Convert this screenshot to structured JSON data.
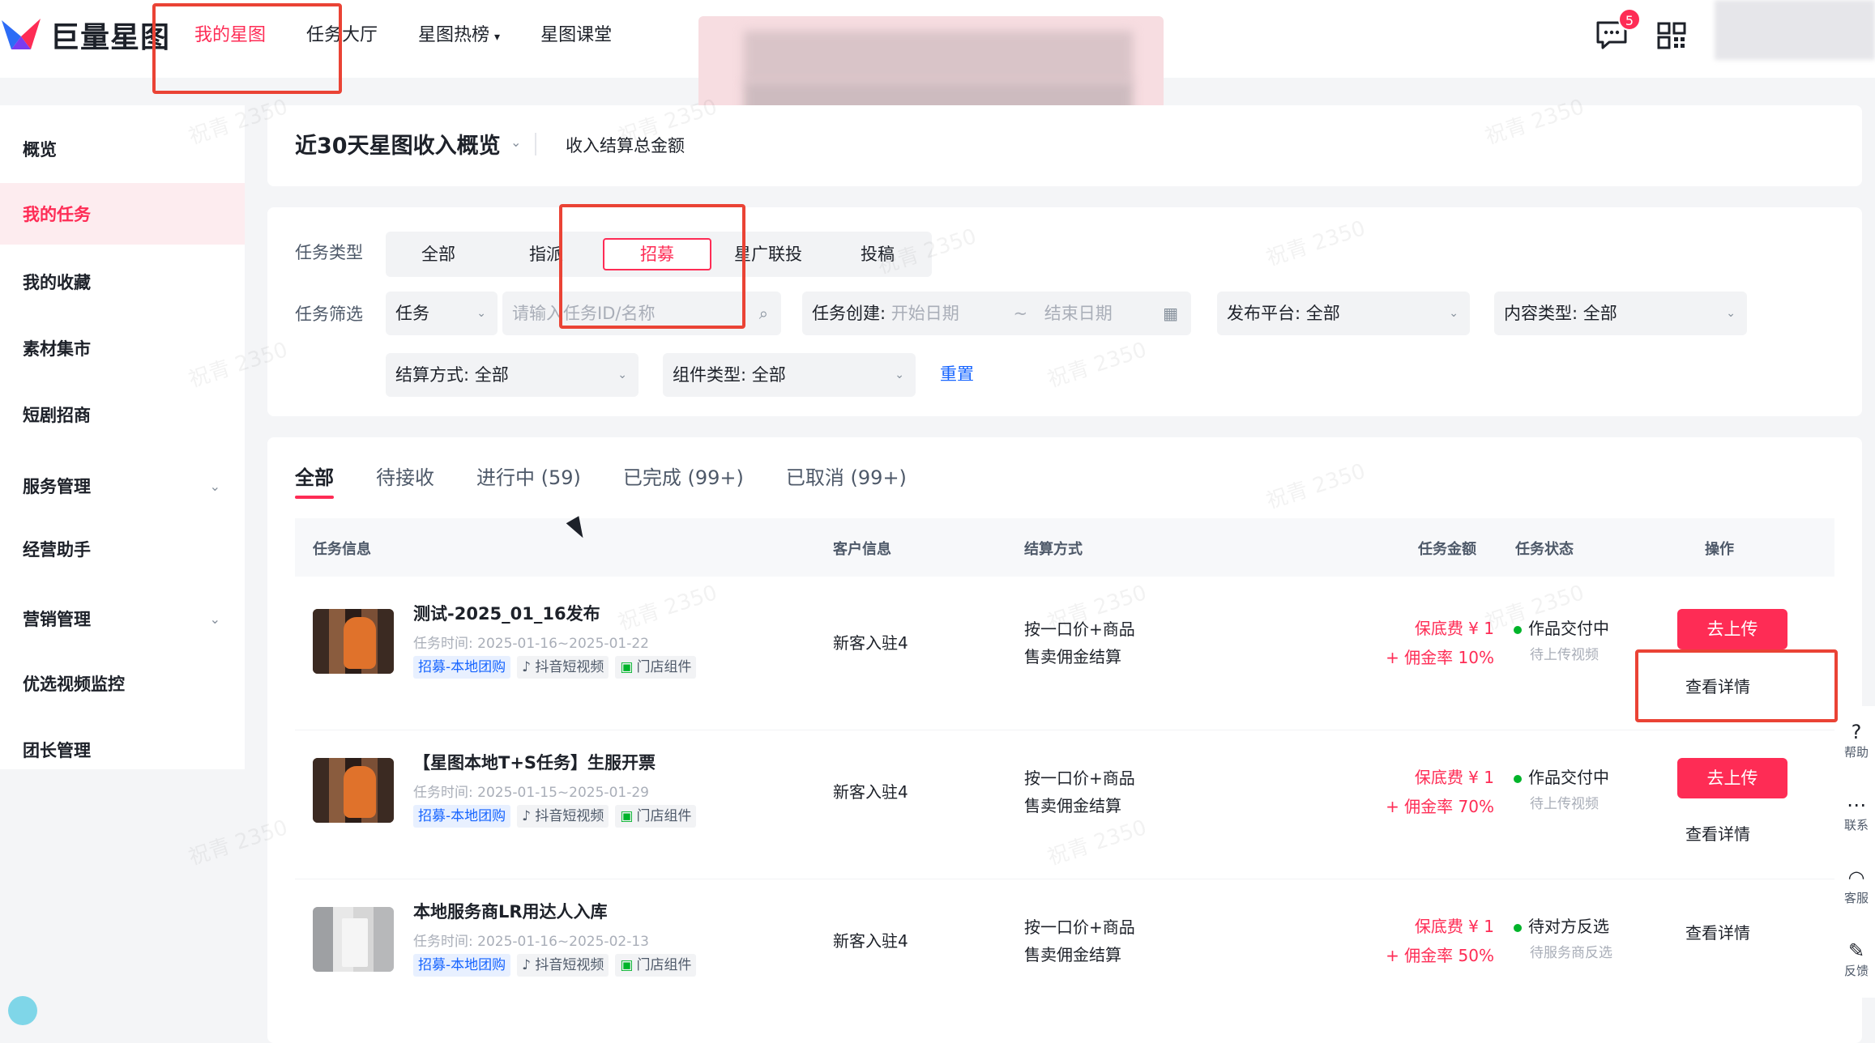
{
  "brand": {
    "name": "巨量星图",
    "accent": "#fe2c55"
  },
  "nav": [
    {
      "label": "我的星图",
      "active": true
    },
    {
      "label": "任务大厅",
      "active": false
    },
    {
      "label": "星图热榜",
      "active": false,
      "caret": "▾"
    },
    {
      "label": "星图课堂",
      "active": false
    }
  ],
  "header": {
    "message_badge": "5"
  },
  "sidebar": [
    {
      "label": "概览"
    },
    {
      "label": "我的任务",
      "active": true
    },
    {
      "label": "我的收藏"
    },
    {
      "label": "素材集市"
    },
    {
      "label": "短剧招商"
    },
    {
      "label": "服务管理",
      "chevron": "⌄"
    },
    {
      "label": "经营助手"
    },
    {
      "label": "营销管理",
      "chevron": "⌄"
    },
    {
      "label": "优选视频监控"
    },
    {
      "label": "团长管理"
    }
  ],
  "summary": {
    "title": "近30天星图收入概览",
    "caret": "⌄",
    "sub": "收入结算总金额"
  },
  "filters": {
    "type_label": "任务类型",
    "types": [
      {
        "label": "全部"
      },
      {
        "label": "指派"
      },
      {
        "label": "招募",
        "selected": true
      },
      {
        "label": "星广联投"
      },
      {
        "label": "投稿"
      }
    ],
    "screen_label": "任务筛选",
    "task_select": "任务",
    "search_placeholder": "请输入任务ID/名称",
    "created_label": "任务创建:",
    "start_placeholder": "开始日期",
    "range_sep": "~",
    "end_placeholder": "结束日期",
    "platform": "发布平台: 全部",
    "content_type": "内容类型: 全部",
    "settle_method": "结算方式: 全部",
    "component_type": "组件类型: 全部",
    "reset": "重置"
  },
  "tabs": [
    {
      "label": "全部",
      "active": true
    },
    {
      "label": "待接收"
    },
    {
      "label": "进行中 (59)"
    },
    {
      "label": "已完成 (99+)"
    },
    {
      "label": "已取消 (99+)"
    }
  ],
  "table": {
    "headers": [
      "任务信息",
      "客户信息",
      "结算方式",
      "任务金额",
      "任务状态",
      "操作"
    ],
    "rows": [
      {
        "title": "测试-2025_01_16发布",
        "time": "任务时间: 2025-01-16~2025-01-22",
        "tags": [
          "招募-本地团购",
          "♪ 抖音短视频",
          "门店组件"
        ],
        "customer": "新客入驻4",
        "settle1": "按一口价+商品",
        "settle2": "售卖佣金结算",
        "amount1": "保底费 ¥ 1",
        "amount2": "+ 佣金率 10%",
        "status": "作品交付中",
        "status_sub": "待上传视频",
        "upload": "去上传",
        "detail": "查看详情"
      },
      {
        "title": "【星图本地T+S任务】生服开票",
        "time": "任务时间: 2025-01-15~2025-01-29",
        "tags": [
          "招募-本地团购",
          "♪ 抖音短视频",
          "门店组件"
        ],
        "customer": "新客入驻4",
        "settle1": "按一口价+商品",
        "settle2": "售卖佣金结算",
        "amount1": "保底费 ¥ 1",
        "amount2": "+ 佣金率 70%",
        "status": "作品交付中",
        "status_sub": "待上传视频",
        "upload": "去上传",
        "detail": "查看详情"
      },
      {
        "title": "本地服务商LR用达人入库",
        "time": "任务时间: 2025-01-16~2025-02-13",
        "tags": [
          "招募-本地团购",
          "♪ 抖音短视频",
          "门店组件"
        ],
        "customer": "新客入驻4",
        "settle1": "按一口价+商品",
        "settle2": "售卖佣金结算",
        "amount1": "保底费 ¥ 1",
        "amount2": "+ 佣金率 50%",
        "status": "待对方反选",
        "status_sub": "待服务商反选",
        "detail": "查看详情"
      }
    ]
  },
  "float_bar": [
    {
      "icon": "?",
      "label": "帮助",
      "icon_name": "help-icon"
    },
    {
      "icon": "⋯",
      "label": "联系",
      "icon_name": "chat-icon"
    },
    {
      "icon": "◠",
      "label": "客服",
      "icon_name": "headset-icon"
    },
    {
      "icon": "✎",
      "label": "反馈",
      "icon_name": "edit-icon"
    }
  ],
  "watermark_text": "祝青 2350"
}
